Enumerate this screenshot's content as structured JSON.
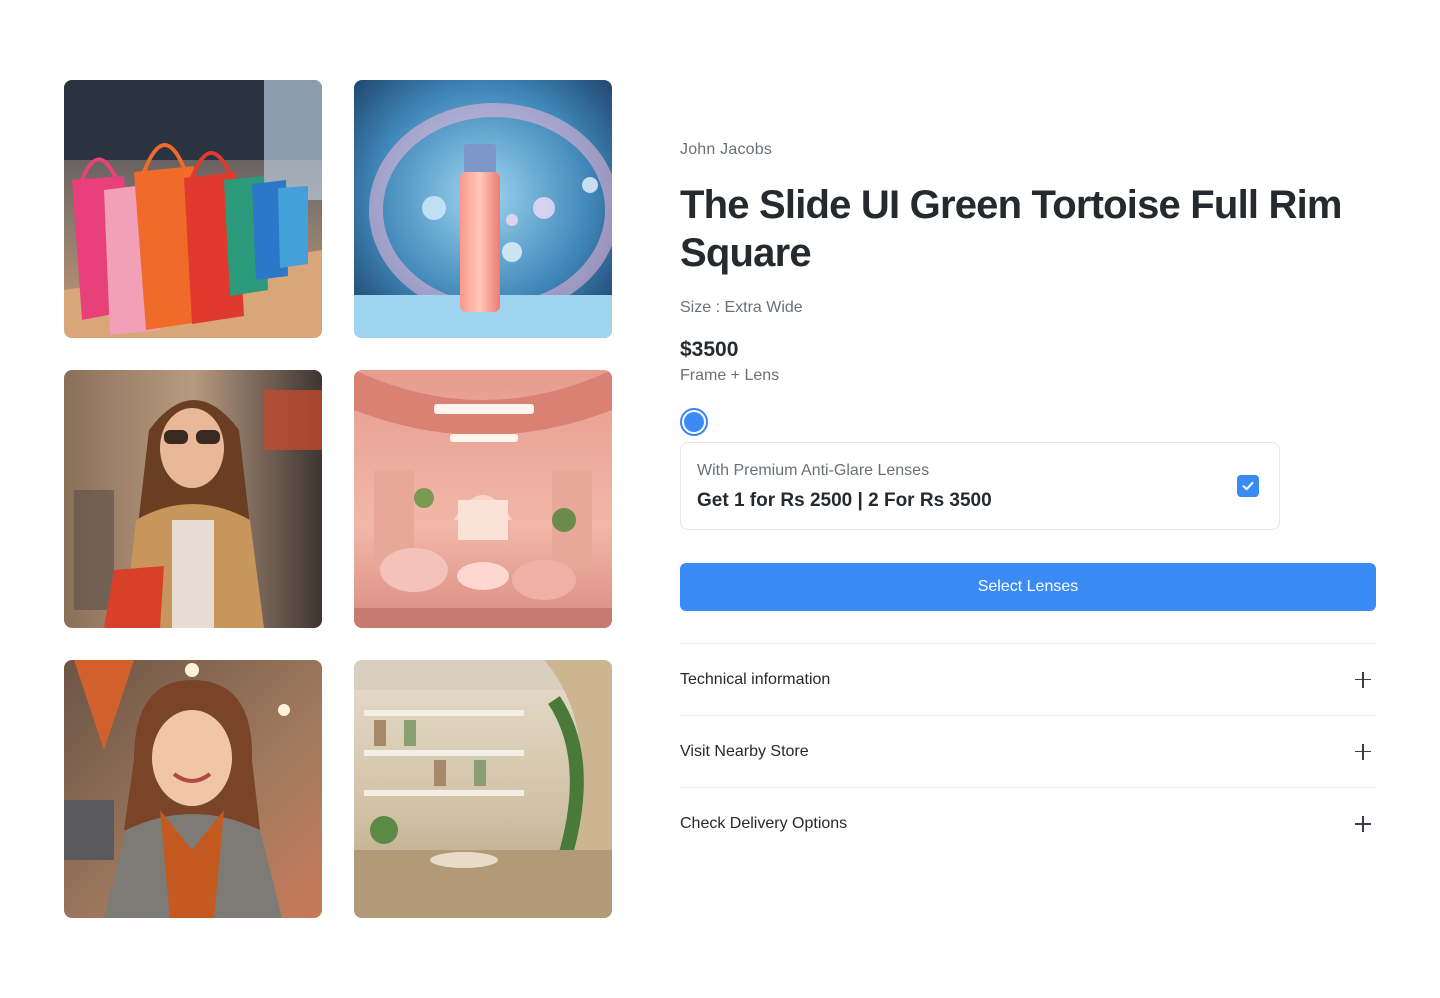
{
  "gallery": {
    "images": [
      {
        "icon": "shopping-bags-image"
      },
      {
        "icon": "cosmetic-bottle-image"
      },
      {
        "icon": "woman-sunglasses-image"
      },
      {
        "icon": "pink-store-interior-image"
      },
      {
        "icon": "smiling-woman-image"
      },
      {
        "icon": "bright-store-interior-image"
      }
    ]
  },
  "product": {
    "brand": "John Jacobs",
    "title": "The Slide UI Green Tortoise Full Rim Square",
    "size": "Size : Extra Wide",
    "price": "$3500",
    "price_note": "Frame + Lens"
  },
  "offer": {
    "subtitle": "With Premium Anti-Glare Lenses",
    "headline": "Get 1 for Rs 2500 | 2 For Rs 3500",
    "checked": true
  },
  "actions": {
    "select_label": "Select Lenses"
  },
  "accordion": [
    {
      "label": "Technical information"
    },
    {
      "label": "Visit Nearby Store"
    },
    {
      "label": "Check Delivery Options"
    }
  ],
  "colors": {
    "accent": "#3b8bf6",
    "text": "#262a2e",
    "muted": "#6b7075"
  }
}
